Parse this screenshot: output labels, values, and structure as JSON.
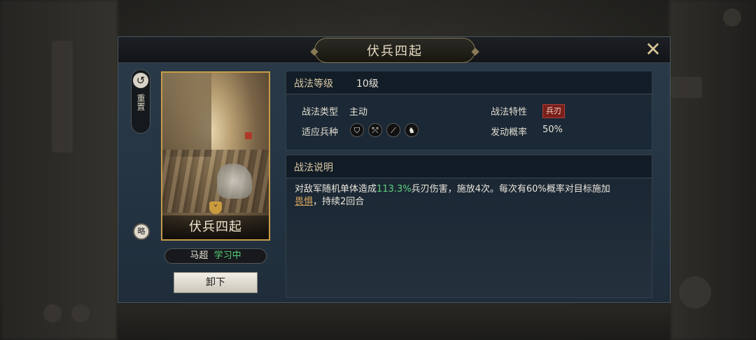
{
  "dialog": {
    "title": "伏兵四起",
    "close_symbol": "✕"
  },
  "side": {
    "reset_label": "重置",
    "reset_symbol": "↺",
    "strategy_label": "略"
  },
  "card": {
    "name": "伏兵四起",
    "badge_symbol": "ᘁ"
  },
  "owner": {
    "name": "马超",
    "status": "学习中"
  },
  "unequip_label": "卸下",
  "info": {
    "level_label": "战法等级",
    "level_value": "10级",
    "type_label": "战法类型",
    "type_value": "主动",
    "trait_label": "战法特性",
    "trait_value": "兵刃",
    "troops_label": "适应兵种",
    "troops": [
      "shield-icon",
      "bow-icon",
      "spear-icon",
      "horse-icon"
    ],
    "troop_symbols": [
      "⛉",
      "⤲",
      "⟋",
      "♞"
    ],
    "chance_label": "发动概率",
    "chance_value": "50%"
  },
  "desc": {
    "header": "战法说明",
    "part1": "对敌军随机单体造成",
    "highlight": "113.3%",
    "part2": "兵刃伤害，施放4次。每次有60%概率对目标施加",
    "link": "畏惧",
    "part3": "，持续2回合"
  },
  "colors": {
    "accent_gold": "#c89c47",
    "highlight_green": "#5fd07e",
    "status_green": "#55d07a",
    "link_orange": "#d7a65a",
    "trait_red": "#7a1f1a"
  }
}
